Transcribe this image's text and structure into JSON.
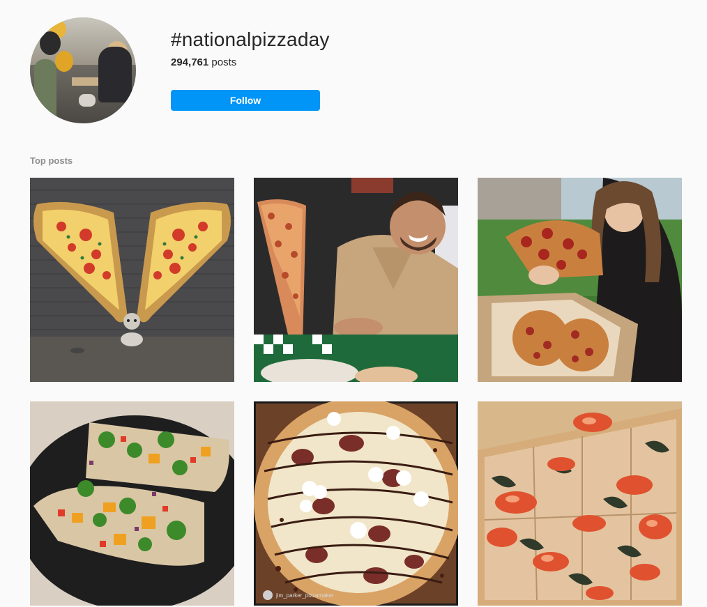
{
  "hashtag": {
    "title": "#nationalpizzaday",
    "post_count": "294,761",
    "post_count_suffix": " posts",
    "follow_label": "Follow"
  },
  "sections": {
    "top_posts_label": "Top posts"
  },
  "posts": [
    {
      "subject": "pizza-wings-mural-with-dog"
    },
    {
      "subject": "man-holding-giant-pizza-slice"
    },
    {
      "subject": "woman-with-pepperoni-pizza-box"
    },
    {
      "subject": "vegetable-flatbread-on-black-plate"
    },
    {
      "subject": "fig-pizza-with-chocolate-drizzle",
      "watermark": "jim_parker_pizzamaker"
    },
    {
      "subject": "lobster-square-pizza-in-box"
    }
  ],
  "colors": {
    "background": "#fafafa",
    "follow_button": "#0095f6",
    "muted_text": "#8e8e8e"
  }
}
